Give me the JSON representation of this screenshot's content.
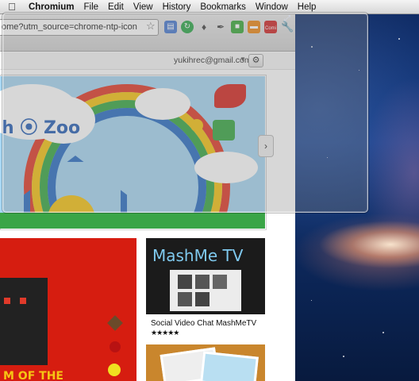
{
  "menubar": {
    "apple_icon": "apple-icon",
    "items": [
      {
        "label": "Chromium",
        "app": true
      },
      {
        "label": "File"
      },
      {
        "label": "Edit"
      },
      {
        "label": "View"
      },
      {
        "label": "History"
      },
      {
        "label": "Bookmarks"
      },
      {
        "label": "Window"
      },
      {
        "label": "Help"
      }
    ]
  },
  "toolbar": {
    "url": "ome?utm_source=chrome-ntp-icon",
    "bookmark_icon": "bookmark-star-icon",
    "extensions": [
      {
        "icon": "notebook-icon",
        "color": "#4a7bd0"
      },
      {
        "icon": "refresh-green-icon",
        "color": "#2fa84a"
      },
      {
        "icon": "tag-icon",
        "color": "#555555"
      },
      {
        "icon": "pen-icon",
        "color": "#666666"
      },
      {
        "icon": "puzzle-icon",
        "color": "#3caa3c"
      },
      {
        "icon": "orange-box-icon",
        "color": "#ee8a1a"
      },
      {
        "icon": "comment-icon",
        "color": "#d02a2a"
      }
    ],
    "comment_badge": "Comi",
    "wrench_icon": "wrench-icon"
  },
  "ntp": {
    "email": "yukihrec@gmail.com",
    "banner_logo": "h ⦿ Zoo",
    "next_arrow": "›"
  },
  "tiles": [
    {
      "name": "MashMe TV",
      "logo_text": "MashMe TV",
      "caption": "Social Video Chat MashMeTV",
      "rating": "★★★★★"
    }
  ],
  "left_tile": {
    "caption_partial": "M OF THE"
  },
  "colors": {
    "menubar": "#e2e2e2",
    "toolbar": "#dcdcdc",
    "banner_sky": "#a8d8f4",
    "left_tile": "#d61d10",
    "wallpaper": "#123b86"
  }
}
